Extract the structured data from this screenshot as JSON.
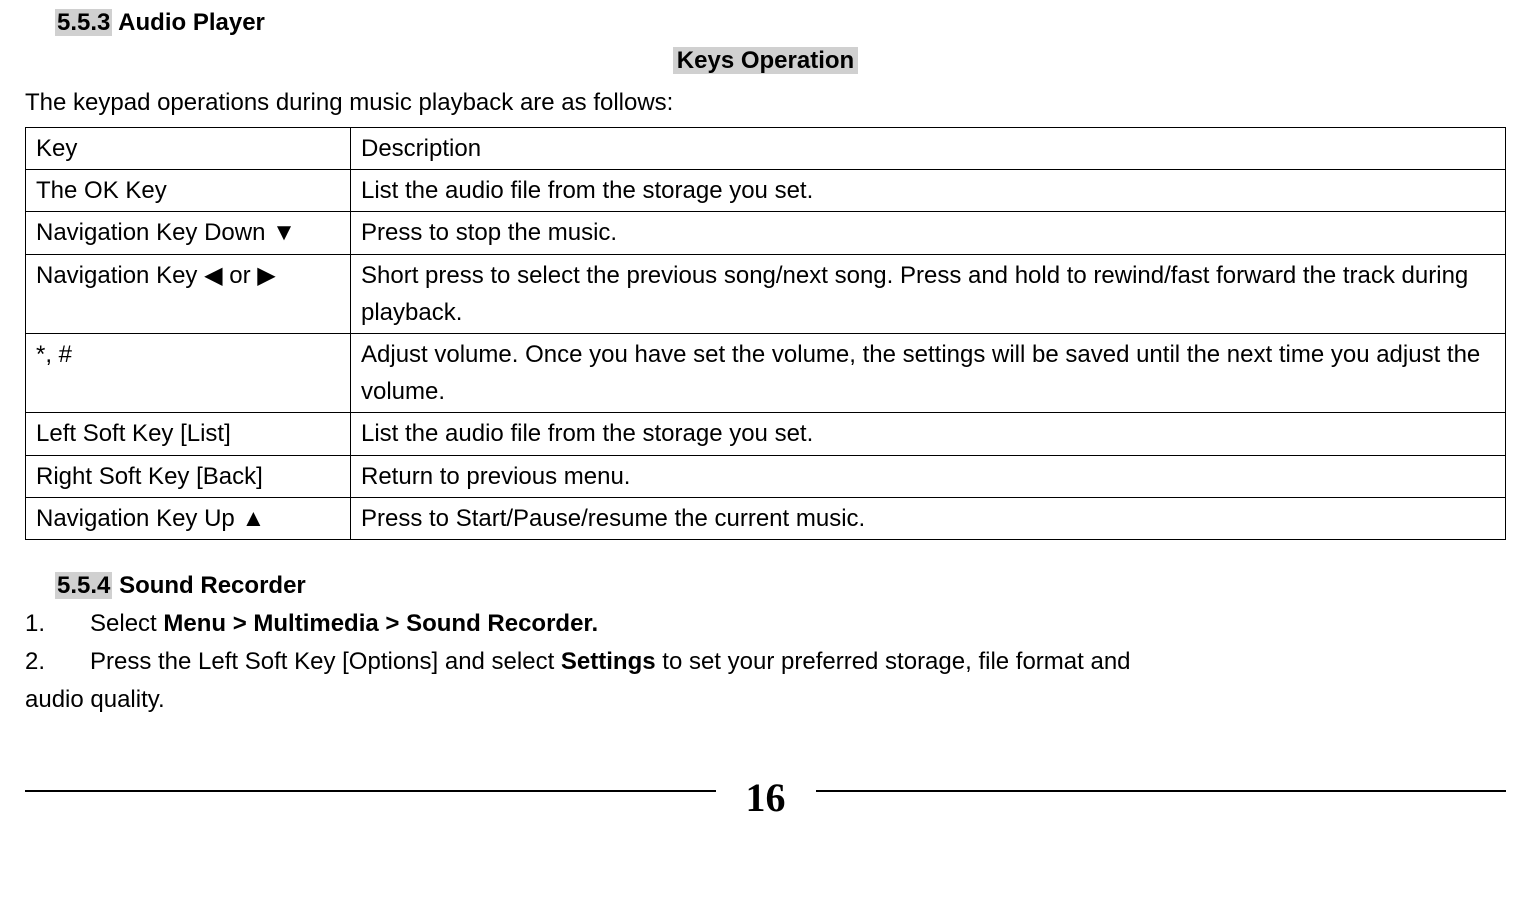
{
  "section1": {
    "num": "5.5.3",
    "title": "Audio Player"
  },
  "subtitle": "Keys Operation",
  "intro": "The keypad operations during music playback are as follows:",
  "table": {
    "rows": [
      {
        "key": "Key",
        "desc": "Description"
      },
      {
        "key": "The OK Key",
        "desc": "List the audio file from the storage you set."
      },
      {
        "key": "Navigation Key Down ▼",
        "desc": "Press to stop the music."
      },
      {
        "key": "Navigation Key ◀ or ▶",
        "desc": "Short press to select the previous song/next song. Press and hold to rewind/fast forward the track during playback."
      },
      {
        "key": "*, #",
        "desc": "Adjust volume. Once you have set the volume, the settings will be saved until the next time you adjust the volume."
      },
      {
        "key": "Left Soft Key [List]",
        "desc": "List the audio file from the storage you set."
      },
      {
        "key": "Right Soft Key [Back]",
        "desc": "Return to previous menu."
      },
      {
        "key": "Navigation Key Up ▲",
        "desc": "Press to Start/Pause/resume the current music."
      }
    ]
  },
  "section2": {
    "num": "5.5.4",
    "title": "Sound Recorder"
  },
  "steps": {
    "item1_num": "1.",
    "item1_pre": "Select ",
    "item1_bold": "Menu > Multimedia > Sound Recorder.",
    "item2_num": "2.",
    "item2_pre": "Press the Left Soft Key [Options] and select ",
    "item2_bold": "Settings",
    "item2_post": " to set your preferred storage, file format and",
    "item2_tail": "audio quality."
  },
  "page_number": "16"
}
